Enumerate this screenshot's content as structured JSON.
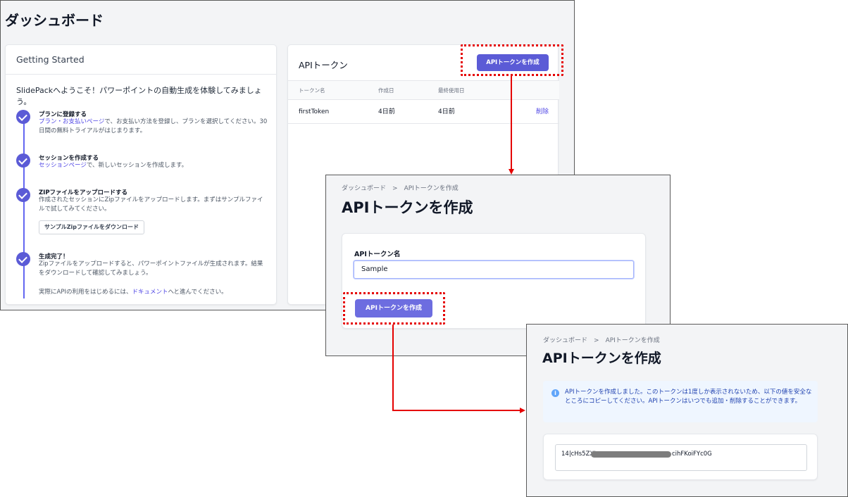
{
  "dashboard": {
    "title": "ダッシュボード",
    "getting_started": {
      "heading": "Getting Started",
      "intro": "SlidePackへようこそ！パワーポイントの自動生成を体験してみましょう。",
      "steps": [
        {
          "title": "プランに登録する",
          "link": "プラン・お支払いページ",
          "desc": "で、お支払い方法を登録し、プランを選択してください。30日間の無料トライアルがはじまります。"
        },
        {
          "title": "セッションを作成する",
          "link": "セッションページ",
          "desc": "で、新しいセッションを作成します。"
        },
        {
          "title": "ZIPファイルをアップロードする",
          "desc": "作成されたセッションにZipファイルをアップロードします。まずはサンプルファイルで試してみてください。",
          "button": "サンプルZipファイルをダウンロード"
        },
        {
          "title": "生成完了！",
          "desc": "Zipファイルをアップロードすると、パワーポイントファイルが生成されます。結果をダウンロードして確認してみましょう。"
        }
      ],
      "footer_prefix": "実際にAPIの利用をはじめるには、",
      "footer_link": "ドキュメント",
      "footer_suffix": "へと進んでください。"
    },
    "api_tokens": {
      "heading": "APIトークン",
      "create_button": "APIトークンを作成",
      "columns": [
        "トークン名",
        "作成日",
        "最終使用日"
      ],
      "rows": [
        {
          "name": "firstToken",
          "created": "4日前",
          "last_used": "4日前",
          "action": "削除"
        }
      ]
    }
  },
  "create_form": {
    "breadcrumb": [
      "ダッシュボード",
      "APIトークンを作成"
    ],
    "breadcrumb_sep": ">",
    "title": "APIトークンを作成",
    "field_label": "APIトークン名",
    "field_value": "Sample",
    "submit_button": "APIトークンを作成"
  },
  "result": {
    "breadcrumb": [
      "ダッシュボード",
      "APIトークンを作成"
    ],
    "breadcrumb_sep": ">",
    "title": "APIトークンを作成",
    "alert": "APIトークンを作成しました。このトークンは1度しか表示されないため、以下の値を安全なところにコピーしてください。APIトークンはいつでも追加・削除することができます。",
    "token_prefix": "14|cHs5ZXI",
    "token_suffix": "cihFKoiFYc0G"
  },
  "colors": {
    "accent": "#5b5bd6",
    "highlight": "#e50000",
    "arrow": "#e50000"
  }
}
